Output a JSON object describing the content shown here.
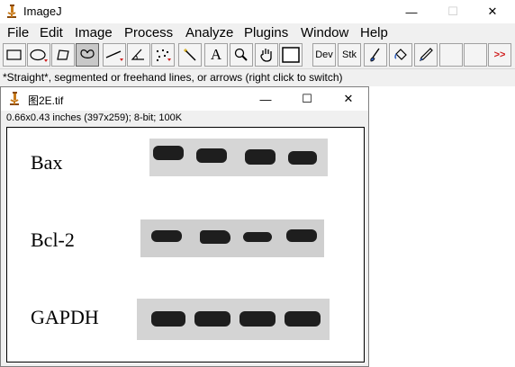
{
  "app": {
    "title": "ImageJ",
    "minimize_glyph": "—",
    "maximize_glyph": "☐",
    "close_glyph": "✕"
  },
  "menu": {
    "items": [
      "File",
      "Edit",
      "Image",
      "Process",
      "Analyze",
      "Plugins",
      "Window",
      "Help"
    ]
  },
  "toolbar": {
    "tools": [
      {
        "name": "rectangle-tool",
        "label": ""
      },
      {
        "name": "oval-tool",
        "label": ""
      },
      {
        "name": "polygon-tool",
        "label": ""
      },
      {
        "name": "freehand-tool",
        "label": ""
      },
      {
        "name": "straight-line-tool",
        "label": ""
      },
      {
        "name": "angle-tool",
        "label": ""
      },
      {
        "name": "multi-point-tool",
        "label": ""
      },
      {
        "name": "wand-tool",
        "label": ""
      },
      {
        "name": "text-tool",
        "label": "A"
      },
      {
        "name": "magnifying-glass-tool",
        "label": ""
      },
      {
        "name": "hand-tool",
        "label": ""
      },
      {
        "name": "color-picker-tool",
        "label": ""
      },
      {
        "name": "developer-menu",
        "label": "Dev"
      },
      {
        "name": "stacks-menu",
        "label": "Stk"
      },
      {
        "name": "brush-tool",
        "label": ""
      },
      {
        "name": "flood-fill-tool",
        "label": ""
      },
      {
        "name": "pencil-tool",
        "label": ""
      },
      {
        "name": "more-tools-button",
        "label": ">>"
      }
    ],
    "selected_tool": "freehand-tool"
  },
  "status": {
    "text": "*Straight*, segmented or freehand lines, or arrows (right click to switch)"
  },
  "image_window": {
    "title": "图2E.tif",
    "info": "0.66x0.43 inches (397x259); 8-bit; 100K",
    "minimize_glyph": "—",
    "maximize_glyph": "☐",
    "close_glyph": "✕"
  },
  "blot": {
    "rows": [
      {
        "label": "Bax"
      },
      {
        "label": "Bcl-2"
      },
      {
        "label": "GAPDH"
      }
    ]
  }
}
